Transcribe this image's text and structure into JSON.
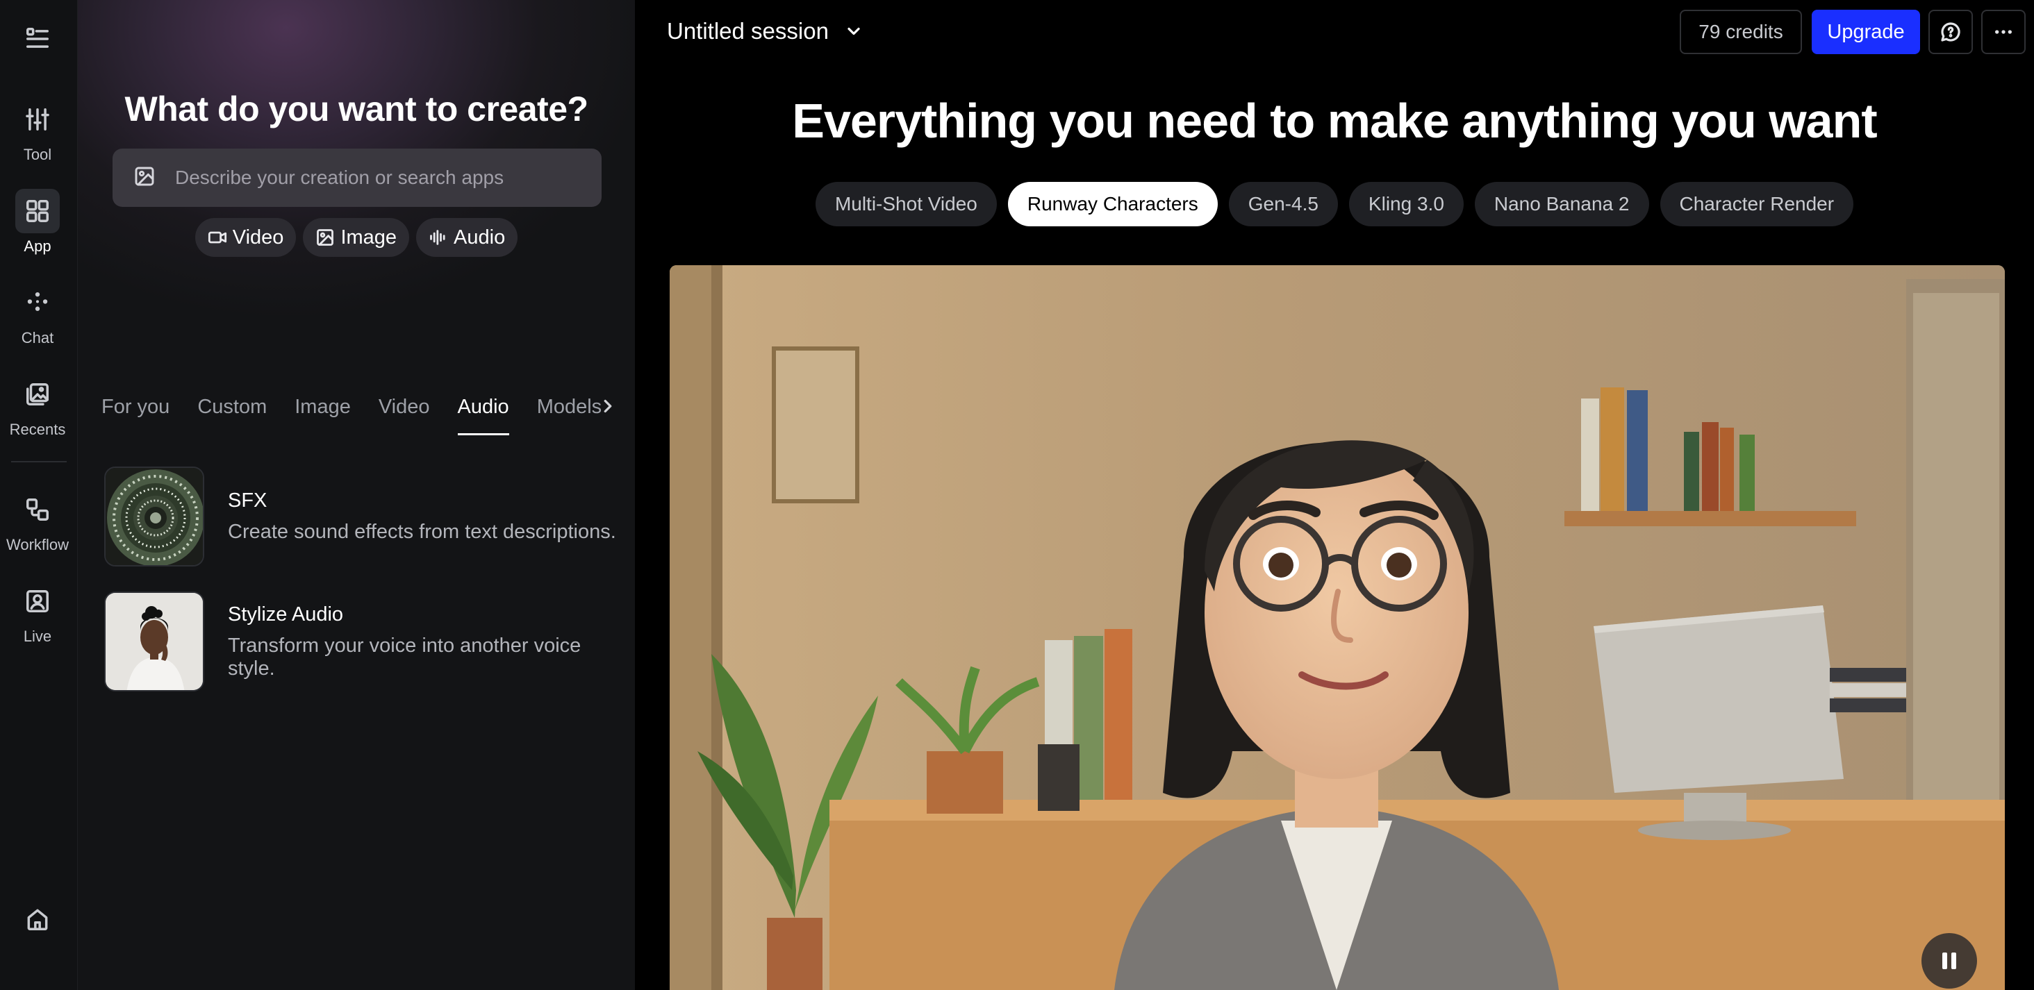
{
  "rail": {
    "items": [
      {
        "label": "",
        "icon": "menu-icon"
      },
      {
        "label": "Tool",
        "icon": "sliders-icon"
      },
      {
        "label": "App",
        "icon": "grid-icon",
        "active": true
      },
      {
        "label": "Chat",
        "icon": "chat-dots-icon"
      },
      {
        "label": "Recents",
        "icon": "images-icon"
      },
      {
        "label": "Workflow",
        "icon": "workflow-icon"
      },
      {
        "label": "Live",
        "icon": "person-frame-icon"
      },
      {
        "label": "",
        "icon": "home-icon"
      }
    ]
  },
  "panel": {
    "title": "What do you want to create?",
    "search_placeholder": "Describe your creation or search apps",
    "chips": [
      {
        "label": "Video",
        "icon": "video-icon"
      },
      {
        "label": "Image",
        "icon": "image-icon"
      },
      {
        "label": "Audio",
        "icon": "audio-wave-icon"
      }
    ],
    "tabs": [
      "For you",
      "Custom",
      "Image",
      "Video",
      "Audio",
      "Models"
    ],
    "active_tab": "Audio",
    "apps": [
      {
        "name": "SFX",
        "description": "Create sound effects from text descriptions."
      },
      {
        "name": "Stylize Audio",
        "description": "Transform your voice into another voice style."
      }
    ]
  },
  "header": {
    "session_title": "Untitled session",
    "credits": "79 credits",
    "upgrade_label": "Upgrade"
  },
  "hero": {
    "title": "Everything you need to make anything you want",
    "pills": [
      "Multi-Shot Video",
      "Runway Characters",
      "Gen-4.5",
      "Kling 3.0",
      "Nano Banana 2",
      "Character Render"
    ],
    "active_pill": "Runway Characters"
  },
  "colors": {
    "accent": "#1a2fff",
    "panel_bg": "#131416",
    "rail_bg": "#111214"
  }
}
